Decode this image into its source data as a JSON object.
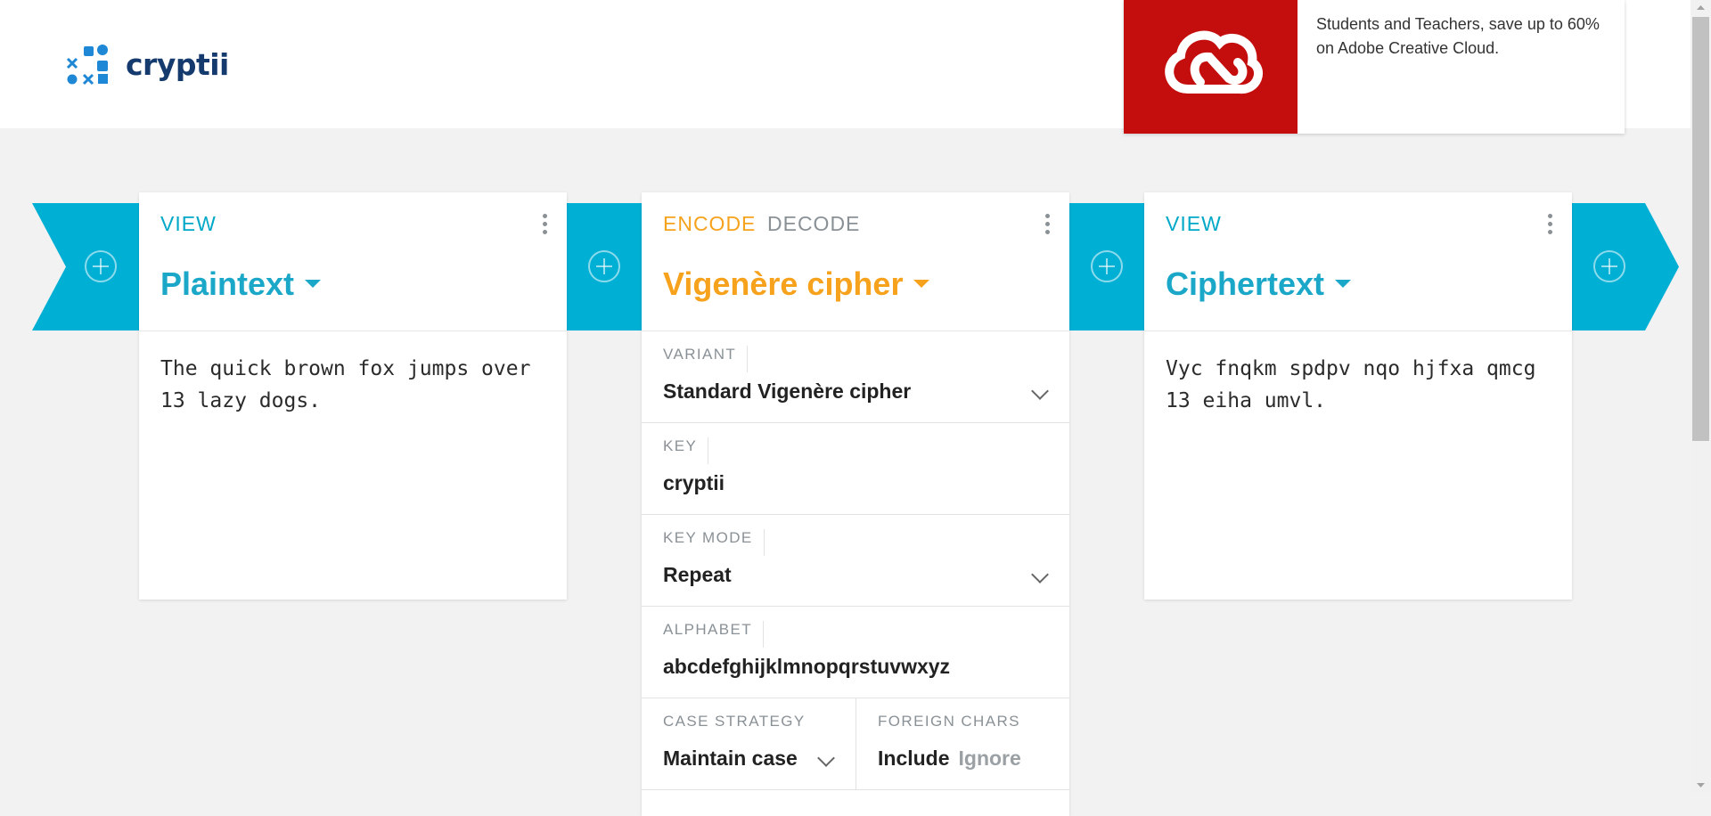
{
  "app": {
    "name": "cryptii"
  },
  "ad": {
    "text": "Students and Teachers, save up to 60% on Adobe Creative Cloud.",
    "brand_color": "#c40e0e"
  },
  "colors": {
    "view_accent": "#00afd4",
    "encode_accent": "#f7a21d",
    "muted": "#8a9196"
  },
  "plaintext_card": {
    "mode": "VIEW",
    "title": "Plaintext",
    "content": "The quick brown fox jumps over 13 lazy dogs."
  },
  "cipher_card": {
    "encode_label": "ENCODE",
    "decode_label": "DECODE",
    "title": "Vigenère cipher",
    "fields": {
      "variant": {
        "label": "VARIANT",
        "value": "Standard Vigenère cipher"
      },
      "key": {
        "label": "KEY",
        "value": "cryptii"
      },
      "key_mode": {
        "label": "KEY MODE",
        "value": "Repeat"
      },
      "alphabet": {
        "label": "ALPHABET",
        "value": "abcdefghijklmnopqrstuvwxyz"
      },
      "case_strategy": {
        "label": "CASE STRATEGY",
        "value": "Maintain case"
      },
      "foreign_chars": {
        "label": "FOREIGN CHARS",
        "option_selected": "Include",
        "option_other": "Ignore"
      }
    }
  },
  "ciphertext_card": {
    "mode": "VIEW",
    "title": "Ciphertext",
    "content": "Vyc fnqkm spdpv nqo hjfxa qmcg 13 eiha umvl."
  }
}
